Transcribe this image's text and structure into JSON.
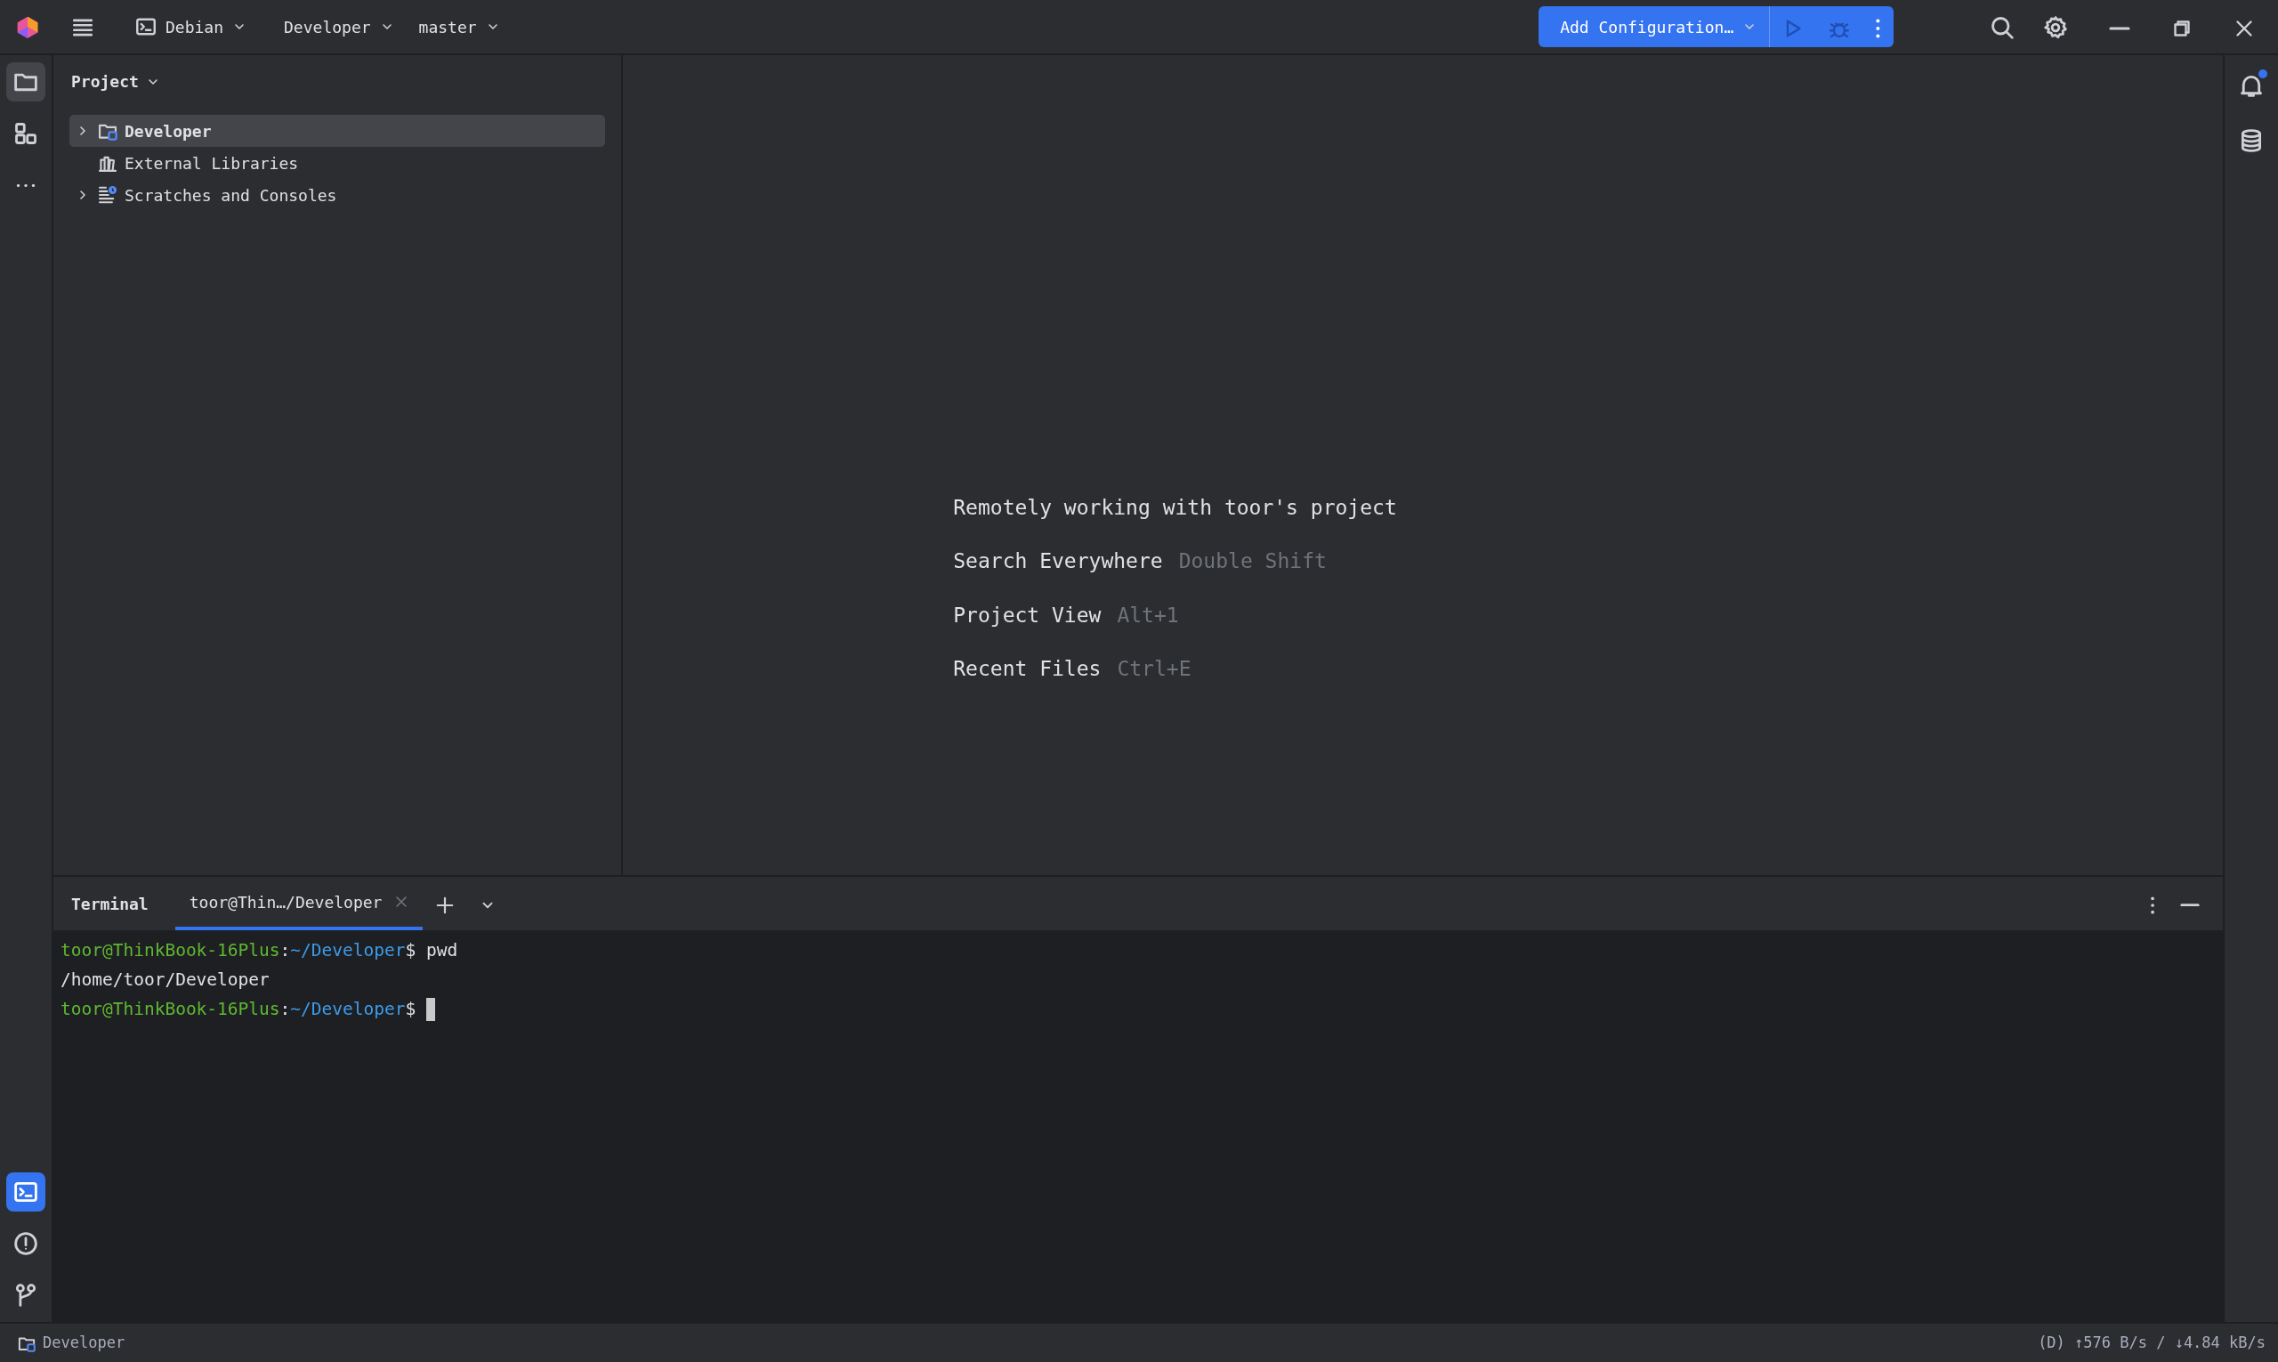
{
  "title_bar": {
    "vcs_widget": {
      "label": "Debian"
    },
    "project": "Developer",
    "branch": "master",
    "run_config": {
      "label": "Add Configuration…"
    }
  },
  "left_toolbar": {
    "top": [
      {
        "kind": "folder",
        "selected": true
      },
      {
        "kind": "structure",
        "selected": false
      },
      {
        "kind": "more",
        "selected": false
      }
    ],
    "bottom": [
      {
        "kind": "terminal",
        "selected": true
      },
      {
        "kind": "problems",
        "selected": false
      },
      {
        "kind": "git",
        "selected": false
      }
    ]
  },
  "right_toolbar": {
    "notifications": {
      "unread": true
    }
  },
  "project_panel": {
    "title": "Project",
    "tree": [
      {
        "label": "Developer",
        "kind": "module",
        "expandable": true,
        "selected": true,
        "bold": true
      },
      {
        "label": "External Libraries",
        "kind": "libraries",
        "expandable": false,
        "selected": false,
        "bold": false
      },
      {
        "label": "Scratches and Consoles",
        "kind": "scratches",
        "expandable": true,
        "selected": false,
        "bold": false
      }
    ]
  },
  "editor": {
    "heading": "Remotely working with toor's project",
    "shortcuts": [
      {
        "action": "Search Everywhere",
        "keys": "Double Shift"
      },
      {
        "action": "Project View",
        "keys": "Alt+1"
      },
      {
        "action": "Recent Files",
        "keys": "Ctrl+E"
      }
    ]
  },
  "terminal": {
    "title": "Terminal",
    "tabs": [
      {
        "label": "toor@Thin…/Developer",
        "selected": true
      }
    ],
    "lines": [
      {
        "kind": "prompt",
        "user": "toor@ThinkBook-16Plus",
        "sep": ":",
        "path": "~/Developer",
        "symbol": "$",
        "command": "pwd",
        "cursor": false
      },
      {
        "kind": "output",
        "text": "/home/toor/Developer"
      },
      {
        "kind": "prompt",
        "user": "toor@ThinkBook-16Plus",
        "sep": ":",
        "path": "~/Developer",
        "symbol": "$",
        "cursor": true
      }
    ]
  },
  "status_bar": {
    "path": "Developer",
    "network": "(D) ↑576 B/s / ↓4.84 kB/s"
  }
}
